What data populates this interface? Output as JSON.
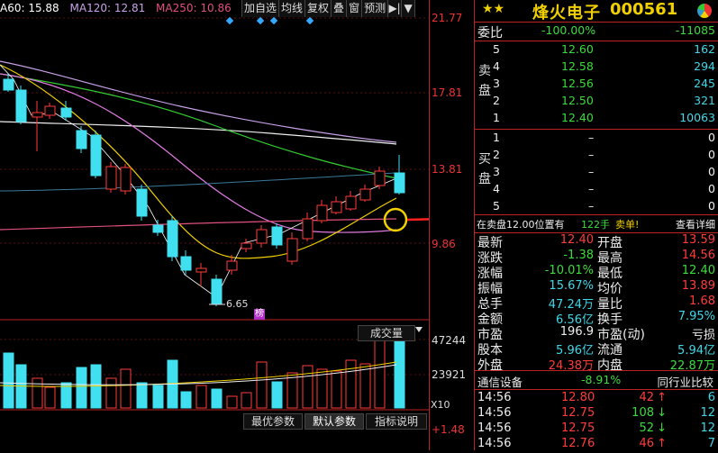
{
  "ma_legend": [
    {
      "label": "A60: 15.88",
      "color": "#ffffff"
    },
    {
      "label": "MA120: 12.81",
      "color": "#c8a0e8"
    },
    {
      "label": "MA250: 10.86",
      "color": "#e05080"
    }
  ],
  "toolbar": {
    "items": [
      "加自选",
      "均线",
      "复权",
      "叠",
      "窗",
      "预测"
    ],
    "icon_fullscreen": "▶|",
    "icon_dropdown": "▼"
  },
  "price_axis": [
    "21.77",
    "17.81",
    "13.81",
    "9.86",
    "-6.65",
    "47244",
    "23921",
    "X10",
    "+1.48"
  ],
  "price_axis_colors": {
    "up": "#ff3c3c",
    "neutral": "#dddddd"
  },
  "chart_annotations": {
    "low_label": "6.65",
    "rank_badge": "榜"
  },
  "volume_label": "成交量",
  "param_buttons": [
    "最优参数",
    "默认参数",
    "指标说明"
  ],
  "quote": {
    "stars": "★★",
    "name": "烽火电子",
    "code": "000561",
    "weibi_label": "委比",
    "weibi_pct": "-100.00%",
    "weibi_val": "-11085",
    "sell_label": "卖盘",
    "buy_label": "买盘",
    "sell": [
      {
        "lvl": "5",
        "price": "12.60",
        "vol": "162"
      },
      {
        "lvl": "4",
        "price": "12.58",
        "vol": "294"
      },
      {
        "lvl": "3",
        "price": "12.56",
        "vol": "245"
      },
      {
        "lvl": "2",
        "price": "12.50",
        "vol": "321"
      },
      {
        "lvl": "1",
        "price": "12.40",
        "vol": "10063"
      }
    ],
    "buy": [
      {
        "lvl": "1",
        "price": "–",
        "vol": "0"
      },
      {
        "lvl": "2",
        "price": "–",
        "vol": "0"
      },
      {
        "lvl": "3",
        "price": "–",
        "vol": "0"
      },
      {
        "lvl": "4",
        "price": "–",
        "vol": "0"
      },
      {
        "lvl": "5",
        "price": "–",
        "vol": "0"
      }
    ],
    "tape_bar": {
      "left": "在卖盘12.00位置有",
      "vol": "122手",
      "tag": "卖单!",
      "link": "查看详细"
    },
    "stats": [
      {
        "l1": "最新",
        "v1": "12.40",
        "c1": "red",
        "l2": "开盘",
        "v2": "13.59",
        "c2": "red"
      },
      {
        "l1": "涨跌",
        "v1": "-1.38",
        "c1": "green",
        "l2": "最高",
        "v2": "14.56",
        "c2": "red"
      },
      {
        "l1": "涨幅",
        "v1": "-10.01%",
        "c1": "green",
        "l2": "最低",
        "v2": "12.40",
        "c2": "green"
      },
      {
        "l1": "振幅",
        "v1": "15.67%",
        "c1": "cyan",
        "l2": "均价",
        "v2": "13.89",
        "c2": "red"
      },
      {
        "l1": "总手",
        "v1": "47.24万",
        "c1": "cyan",
        "l2": "量比",
        "v2": "1.68",
        "c2": "red"
      },
      {
        "l1": "金额",
        "v1": "6.56亿",
        "c1": "cyan",
        "l2": "换手",
        "v2": "7.95%",
        "c2": "cyan"
      },
      {
        "l1": "市盈",
        "v1": "196.9",
        "c1": "white",
        "l2": "市盈(动)",
        "v2": "亏损",
        "c2": "white"
      },
      {
        "l1": "股本",
        "v1": "5.96亿",
        "c1": "cyan",
        "l2": "流通",
        "v2": "5.94亿",
        "c2": "cyan"
      },
      {
        "l1": "外盘",
        "v1": "24.38万",
        "c1": "red",
        "l2": "内盘",
        "v2": "22.87万",
        "c2": "green"
      }
    ],
    "sector": {
      "name": "通信设备",
      "pct": "-8.91%",
      "compare": "同行业比较"
    },
    "ticks": [
      {
        "time": "14:56",
        "price": "12.80",
        "vol": "42",
        "dir": "up",
        "n": "6"
      },
      {
        "time": "14:56",
        "price": "12.75",
        "vol": "108",
        "dir": "down",
        "n": "12"
      },
      {
        "time": "14:56",
        "price": "12.75",
        "vol": "52",
        "dir": "down",
        "n": "12"
      },
      {
        "time": "14:56",
        "price": "12.76",
        "vol": "46",
        "dir": "up",
        "n": "7"
      }
    ]
  }
}
